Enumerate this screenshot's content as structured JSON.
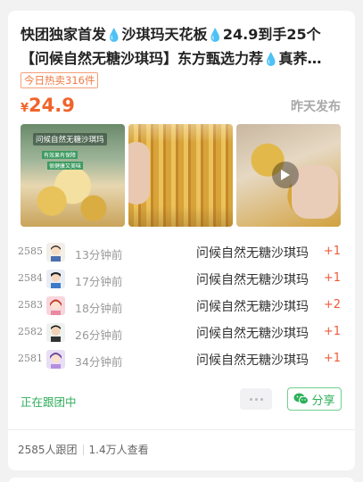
{
  "post": {
    "title_line1": "快团独家首发💧沙琪玛天花板💧24.9到手25个",
    "title_line1_parts": [
      "快团独家首发",
      "沙琪玛天花板",
      "24.9到手25个"
    ],
    "title_line2_parts": [
      "【问候自然无糖沙琪玛】东方甄选力荐",
      "真荞…"
    ],
    "hot_badge": "今日热卖316件",
    "currency": "¥",
    "price": "24.9",
    "posted_time": "昨天发布"
  },
  "orders": [
    {
      "rank": "2585",
      "time": "13分钟前",
      "item": "问候自然无糖沙琪玛",
      "qty": "+1",
      "avatar": "avatar-cartoon-girl"
    },
    {
      "rank": "2584",
      "time": "17分钟前",
      "item": "问候自然无糖沙琪玛",
      "qty": "+1",
      "avatar": "avatar-cartoon-boy"
    },
    {
      "rank": "2583",
      "time": "18分钟前",
      "item": "问候自然无糖沙琪玛",
      "qty": "+2",
      "avatar": "avatar-pink-girl"
    },
    {
      "rank": "2582",
      "time": "26分钟前",
      "item": "问候自然无糖沙琪玛",
      "qty": "+1",
      "avatar": "avatar-cartoon-man"
    },
    {
      "rank": "2581",
      "time": "34分钟前",
      "item": "问候自然无糖沙琪玛",
      "qty": "+1",
      "avatar": "avatar-purple-girl"
    }
  ],
  "actions": {
    "status": "正在跟团中",
    "share_label": "分享"
  },
  "stats": {
    "followers": "2585人跟团",
    "views": "1.4万人查看"
  },
  "images": {
    "photo1_caption": "问候自然无糖沙琪玛",
    "photo1_tag1": "有效果有保障",
    "photo1_tag2": "很健康又美味"
  },
  "colors": {
    "price": "#f0642b",
    "accent_green": "#2bb05a",
    "qty_red": "#f05a3a"
  }
}
